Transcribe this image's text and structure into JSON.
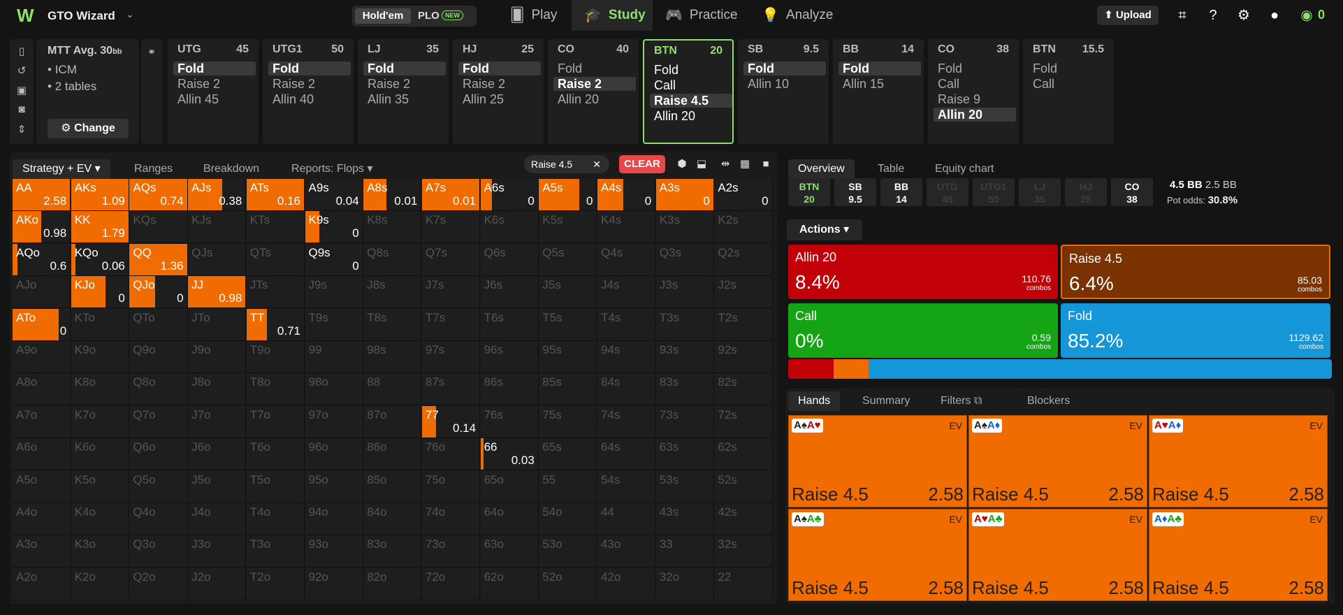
{
  "header": {
    "brand": "GTO Wizard",
    "toggle_a": "Hold'em",
    "toggle_b": "PLO",
    "toggle_badge": "NEW",
    "nav": [
      {
        "label": "Play"
      },
      {
        "label": "Study"
      },
      {
        "label": "Practice"
      },
      {
        "label": "Analyze"
      }
    ],
    "upload": "Upload",
    "balance": "0"
  },
  "colors": {
    "accent": "#8fe06a",
    "raise": "#f06c00",
    "allin": "#c20008",
    "call": "#14a414",
    "fold": "#1496d8",
    "raise_box": "#7a3200"
  },
  "mtt": {
    "title": "MTT",
    "avg": "Avg. 30",
    "avg_unit": "bb",
    "items": [
      "ICM",
      "2 tables"
    ],
    "change": "Change"
  },
  "positions": [
    {
      "name": "UTG",
      "stack": "45",
      "actions": [
        "Fold",
        "Raise 2",
        "Allin 45"
      ],
      "hl": 0
    },
    {
      "name": "UTG1",
      "stack": "50",
      "actions": [
        "Fold",
        "Raise 2",
        "Allin 40"
      ],
      "hl": 0
    },
    {
      "name": "LJ",
      "stack": "35",
      "actions": [
        "Fold",
        "Raise 2",
        "Allin 35"
      ],
      "hl": 0
    },
    {
      "name": "HJ",
      "stack": "25",
      "actions": [
        "Fold",
        "Raise 2",
        "Allin 25"
      ],
      "hl": 0
    },
    {
      "name": "CO",
      "stack": "40",
      "actions": [
        "Fold",
        "Raise 2",
        "Allin 20"
      ],
      "hl": 1
    },
    {
      "name": "BTN",
      "stack": "20",
      "actions": [
        "Fold",
        "Call",
        "Raise 4.5",
        "Allin 20"
      ],
      "hl": 2,
      "selected": true
    },
    {
      "name": "SB",
      "stack": "9.5",
      "actions": [
        "Fold",
        "Allin 10"
      ],
      "hl": 0
    },
    {
      "name": "BB",
      "stack": "14",
      "actions": [
        "Fold",
        "Allin 15"
      ],
      "hl": 0
    },
    {
      "name": "CO",
      "stack": "38",
      "actions": [
        "Fold",
        "Call",
        "Raise 9",
        "Allin 20"
      ],
      "hl": 3
    },
    {
      "name": "BTN",
      "stack": "15.5",
      "actions": [
        "Fold",
        "Call"
      ],
      "hl": -1
    }
  ],
  "gridtabs": {
    "t1": "Strategy + EV",
    "t2": "Ranges",
    "t3": "Breakdown",
    "t4": "Reports: Flops"
  },
  "chip": "Raise 4.5",
  "clear": "CLEAR",
  "matrix": {
    "ranks": [
      "A",
      "K",
      "Q",
      "J",
      "T",
      "9",
      "8",
      "7",
      "6",
      "5",
      "4",
      "3",
      "2"
    ],
    "cells": {
      "0,0": [
        1,
        "2.58"
      ],
      "0,1": [
        1,
        "1.09"
      ],
      "0,2": [
        1,
        "0.74"
      ],
      "0,3": [
        0.6,
        "0.38"
      ],
      "0,4": [
        1,
        "0.16"
      ],
      "0,5": [
        0,
        "0.04"
      ],
      "0,6": [
        0.4,
        "0.01"
      ],
      "0,7": [
        1,
        "0.01"
      ],
      "0,8": [
        0.2,
        "0"
      ],
      "0,9": [
        0.7,
        "0"
      ],
      "0,10": [
        0.45,
        "0"
      ],
      "0,11": [
        1,
        "0"
      ],
      "0,12": [
        0,
        "0"
      ],
      "1,0": [
        0.5,
        "0.98"
      ],
      "1,1": [
        1,
        "1.79"
      ],
      "1,5": [
        0.25,
        "0"
      ],
      "2,0": [
        0.08,
        "0.6"
      ],
      "2,1": [
        0.08,
        "0.06"
      ],
      "2,2": [
        1,
        "1.36"
      ],
      "2,5": [
        0,
        "0"
      ],
      "3,1": [
        0.6,
        "0"
      ],
      "3,2": [
        0.45,
        "0"
      ],
      "3,3": [
        1,
        "0.98"
      ],
      "4,0": [
        0.8,
        "0"
      ],
      "4,4": [
        0.35,
        "0.71"
      ],
      "7,7": [
        0.25,
        "0.14"
      ],
      "8,8": [
        0.05,
        "0.03"
      ]
    }
  },
  "right": {
    "tabs": [
      "Overview",
      "Table",
      "Equity chart"
    ],
    "ptabs": [
      {
        "n": "BTN",
        "v": "20",
        "c": "green"
      },
      {
        "n": "SB",
        "v": "9.5"
      },
      {
        "n": "BB",
        "v": "14"
      },
      {
        "n": "UTG",
        "v": "45",
        "c": "dim"
      },
      {
        "n": "UTG1",
        "v": "50",
        "c": "dim"
      },
      {
        "n": "LJ",
        "v": "35",
        "c": "dim"
      },
      {
        "n": "HJ",
        "v": "25",
        "c": "dim"
      },
      {
        "n": "CO",
        "v": "38"
      }
    ],
    "pot": "4.5 BB",
    "pot2": "2.5 BB",
    "potodds_label": "Pot odds:",
    "potodds": "30.8%",
    "actions_label": "Actions",
    "actions": [
      {
        "label": "Allin 20",
        "pct": "8.4%",
        "combos": "110.76"
      },
      {
        "label": "Raise 4.5",
        "pct": "6.4%",
        "combos": "85.03"
      },
      {
        "label": "Call",
        "pct": "0%",
        "combos": "0.59"
      },
      {
        "label": "Fold",
        "pct": "85.2%",
        "combos": "1129.62"
      }
    ],
    "combos_word": "combos",
    "stack_fracs": [
      0.084,
      0.064,
      0.0,
      0.852
    ],
    "htabs": [
      "Hands",
      "Summary",
      "Filters",
      "Blockers"
    ],
    "hands": [
      {
        "c1": "A♠",
        "c2": "A♥",
        "c1col": "#222",
        "c2col": "#c20008"
      },
      {
        "c1": "A♠",
        "c2": "A♦",
        "c1col": "#222",
        "c2col": "#1460d8"
      },
      {
        "c1": "A♥",
        "c2": "A♦",
        "c1col": "#c20008",
        "c2col": "#1460d8"
      },
      {
        "c1": "A♠",
        "c2": "A♣",
        "c1col": "#222",
        "c2col": "#14a414"
      },
      {
        "c1": "A♥",
        "c2": "A♣",
        "c1col": "#c20008",
        "c2col": "#14a414"
      },
      {
        "c1": "A♦",
        "c2": "A♣",
        "c1col": "#1460d8",
        "c2col": "#14a414"
      }
    ],
    "hand_action": "Raise 4.5",
    "hand_ev": "2.58",
    "ev_label": "EV"
  }
}
